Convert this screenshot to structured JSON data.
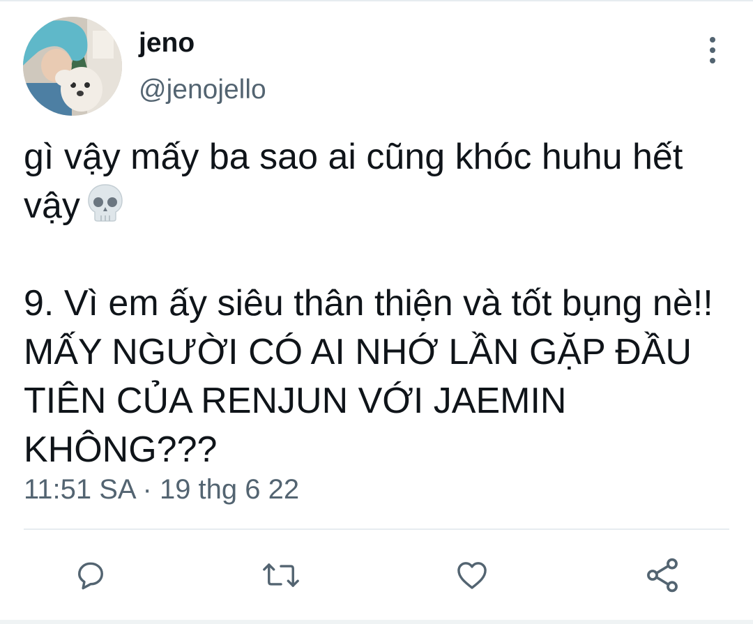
{
  "tweet": {
    "author": {
      "display_name": "jeno",
      "handle": "@jenojello"
    },
    "text": {
      "paragraph_1": "gì vậy mấy ba sao ai cũng khóc huhu hết vậy",
      "paragraph_1_emoji": "skull-icon",
      "paragraph_2": "9. Vì em ấy siêu thân thiện và tốt bụng nè!! MẤY NGƯỜI CÓ AI NHỚ LẦN GẶP ĐẦU TIÊN CỦA RENJUN VỚI JAEMIN KHÔNG???"
    },
    "timestamp": "11:51 SA · 19 thg 6 22"
  },
  "actions": [
    {
      "name": "reply",
      "icon": "comment-icon"
    },
    {
      "name": "retweet",
      "icon": "retweet-icon"
    },
    {
      "name": "like",
      "icon": "heart-icon"
    },
    {
      "name": "share",
      "icon": "share-icon"
    }
  ],
  "colors": {
    "text_primary": "#0f1419",
    "text_secondary": "#536471",
    "divider": "#e6ecf0",
    "avatar_hair": "#5fb8c9"
  }
}
